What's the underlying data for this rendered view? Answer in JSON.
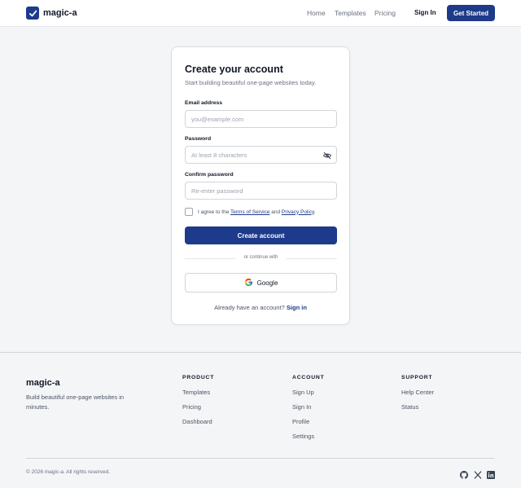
{
  "header": {
    "brand": "magic-a",
    "nav": [
      "Home",
      "Templates",
      "Pricing"
    ],
    "sign_in": "Sign In",
    "cta": "Get Started"
  },
  "card": {
    "title": "Create your account",
    "subtitle": "Start building beautiful one-page websites today.",
    "email": {
      "label": "Email address",
      "placeholder": "you@example.com",
      "value": ""
    },
    "password": {
      "label": "Password",
      "placeholder": "At least 8 characters",
      "value": ""
    },
    "confirm": {
      "label": "Confirm password",
      "placeholder": "Re-enter password",
      "value": ""
    },
    "agree": {
      "prefix": "I agree to the",
      "terms": "Terms of Service",
      "and": "and",
      "privacy": "Privacy Policy",
      "suffix": ".",
      "checked": false
    },
    "submit": "Create account",
    "divider": "or continue with",
    "google": "Google",
    "have_account": "Already have an account?",
    "sign_in_link": "Sign in"
  },
  "footer": {
    "brand": "magic-a",
    "description": "Build beautiful one-page websites in minutes.",
    "columns": [
      {
        "heading": "PRODUCT",
        "links": [
          "Templates",
          "Pricing",
          "Dashboard"
        ]
      },
      {
        "heading": "ACCOUNT",
        "links": [
          "Sign Up",
          "Sign In",
          "Profile",
          "Settings"
        ]
      },
      {
        "heading": "SUPPORT",
        "links": [
          "Help Center",
          "Status"
        ]
      }
    ],
    "copyright": "© 2026 magic-a. All rights reserved.",
    "social_icons": [
      "github-icon",
      "x-icon",
      "linkedin-icon"
    ]
  },
  "colors": {
    "brand": "#1e3a8a",
    "background": "#f4f5f7",
    "text": "#111827",
    "muted": "#6b7280"
  }
}
